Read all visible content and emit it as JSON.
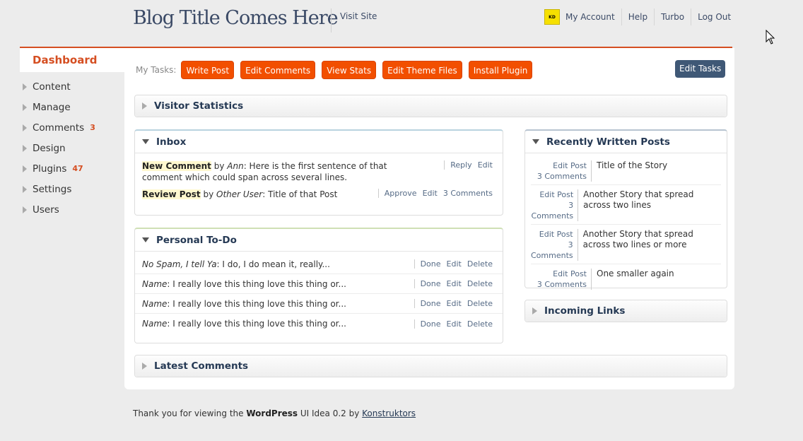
{
  "header": {
    "blog_title": "Blog Title Comes Here",
    "visit_site": "Visit Site",
    "logo_text": "KD",
    "nav": [
      "My Account",
      "Help",
      "Turbo",
      "Log Out"
    ]
  },
  "sidebar": {
    "active": "Dashboard",
    "items": [
      {
        "label": "Content",
        "count": ""
      },
      {
        "label": "Manage",
        "count": ""
      },
      {
        "label": "Comments",
        "count": "3"
      },
      {
        "label": "Design",
        "count": ""
      },
      {
        "label": "Plugins",
        "count": "47"
      },
      {
        "label": "Settings",
        "count": ""
      },
      {
        "label": "Users",
        "count": ""
      }
    ]
  },
  "tasks": {
    "label": "My Tasks:",
    "buttons": [
      "Write Post",
      "Edit Comments",
      "View Stats",
      "Edit Theme Files",
      "Install Plugin"
    ],
    "edit_tasks": "Edit Tasks"
  },
  "visitor_stats": {
    "title": "Visitor Statistics"
  },
  "inbox": {
    "title": "Inbox",
    "rows": [
      {
        "type": "New Comment",
        "by": " by ",
        "author": "Ann",
        "text": ": Here is the first sentence of that comment which could span across several lines.",
        "actions": [
          "Reply",
          "Edit"
        ]
      },
      {
        "type": "Review Post",
        "by": " by ",
        "author": "Other User",
        "text": ": Title of that Post",
        "actions": [
          "Approve",
          "Edit",
          "3 Comments"
        ]
      }
    ]
  },
  "todo": {
    "title": "Personal To-Do",
    "rows": [
      {
        "name": "No Spam, I tell Ya",
        "text": ": I do, I do mean it, really...",
        "actions": [
          "Done",
          "Edit",
          "Delete"
        ]
      },
      {
        "name": "Name",
        "text": ": I really love this thing love this thing or...",
        "actions": [
          "Done",
          "Edit",
          "Delete"
        ]
      },
      {
        "name": "Name",
        "text": ": I really love this thing love this thing or...",
        "actions": [
          "Done",
          "Edit",
          "Delete"
        ]
      },
      {
        "name": "Name",
        "text": ": I really love this thing love this thing or...",
        "actions": [
          "Done",
          "Edit",
          "Delete"
        ]
      }
    ]
  },
  "latest_comments": {
    "title": "Latest Comments"
  },
  "recent_posts": {
    "title": "Recently Written Posts",
    "rows": [
      {
        "edit": "Edit Post",
        "comments": "3 Comments",
        "title": "Title of the Story"
      },
      {
        "edit": "Edit Post",
        "comments": "3 Comments",
        "title": "Another Story that spread across two lines"
      },
      {
        "edit": "Edit Post",
        "comments": "3 Comments",
        "title": "Another Story that spread across two lines or more"
      },
      {
        "edit": "Edit Post",
        "comments": "3 Comments",
        "title": "One smaller again"
      }
    ]
  },
  "incoming_links": {
    "title": "Incoming Links"
  },
  "footer": {
    "prefix": "Thank you for viewing the ",
    "brand": "WordPress",
    "middle": " UI Idea 0.2 by ",
    "link": "Konstruktors"
  },
  "colors": {
    "accent": "#d54e21",
    "task_button": "#f24f00",
    "edit_tasks": "#3f5876",
    "heading": "#253954"
  }
}
